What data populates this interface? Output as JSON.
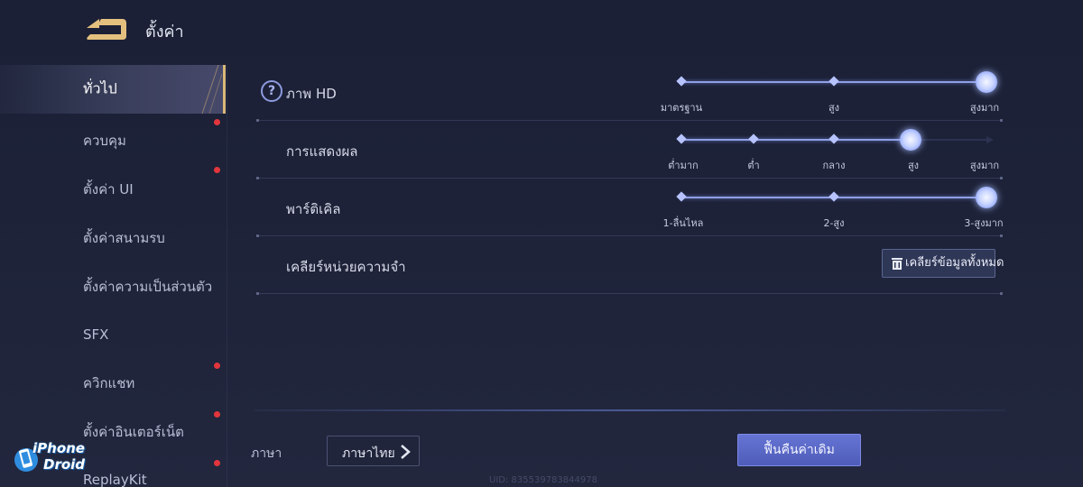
{
  "header": {
    "title": "ตั้งค่า",
    "back_icon": "back-arrow-icon"
  },
  "sidebar": {
    "items": [
      {
        "label": "ทั่วไป",
        "active": true,
        "dot": false
      },
      {
        "label": "ควบคุม",
        "active": false,
        "dot": true
      },
      {
        "label": "ตั้งค่า UI",
        "active": false,
        "dot": true
      },
      {
        "label": "ตั้งค่าสนามรบ",
        "active": false,
        "dot": false
      },
      {
        "label": "ตั้งค่าความเป็นส่วนตัว",
        "active": false,
        "dot": false
      },
      {
        "label": "SFX",
        "active": false,
        "dot": false
      },
      {
        "label": "ควิกแชท",
        "active": false,
        "dot": true
      },
      {
        "label": "ตั้งค่าอินเตอร์เน็ต",
        "active": false,
        "dot": true
      },
      {
        "label": "ReplayKit",
        "active": false,
        "dot": true
      }
    ]
  },
  "settings": {
    "hd": {
      "label": "ภาพ HD",
      "help_icon": "?",
      "stops": [
        "มาตรฐาน",
        "สูง",
        "สูงมาก"
      ],
      "selected_index": 2
    },
    "display": {
      "label": "การแสดงผล",
      "stops": [
        "ต่ำมาก",
        "ต่ำ",
        "กลาง",
        "สูง",
        "สูงมาก"
      ],
      "selected_index": 3
    },
    "particle": {
      "label": "พาร์ติเคิล",
      "stops": [
        "1-ลื่นไหล",
        "2-สูง",
        "3-สูงมาก"
      ],
      "selected_index": 2
    },
    "cache": {
      "label": "เคลียร์หน่วยความจำ",
      "button_label": "เคลียร์ข้อมูลทั้งหมด",
      "button_icon": "trash-icon"
    }
  },
  "footer": {
    "language_caption": "ภาษา",
    "language_value": "ภาษาไทย",
    "reset_label": "ฟื้นคืนค่าเดิม",
    "uid": "UID: 835539783844978"
  },
  "watermark": {
    "line1": "iPhone",
    "line2": "Droid"
  },
  "colors": {
    "accent": "#8fa0e6",
    "active_border": "#d9b878",
    "notify_dot": "#e2363c",
    "reset_button": "#5866c4"
  }
}
